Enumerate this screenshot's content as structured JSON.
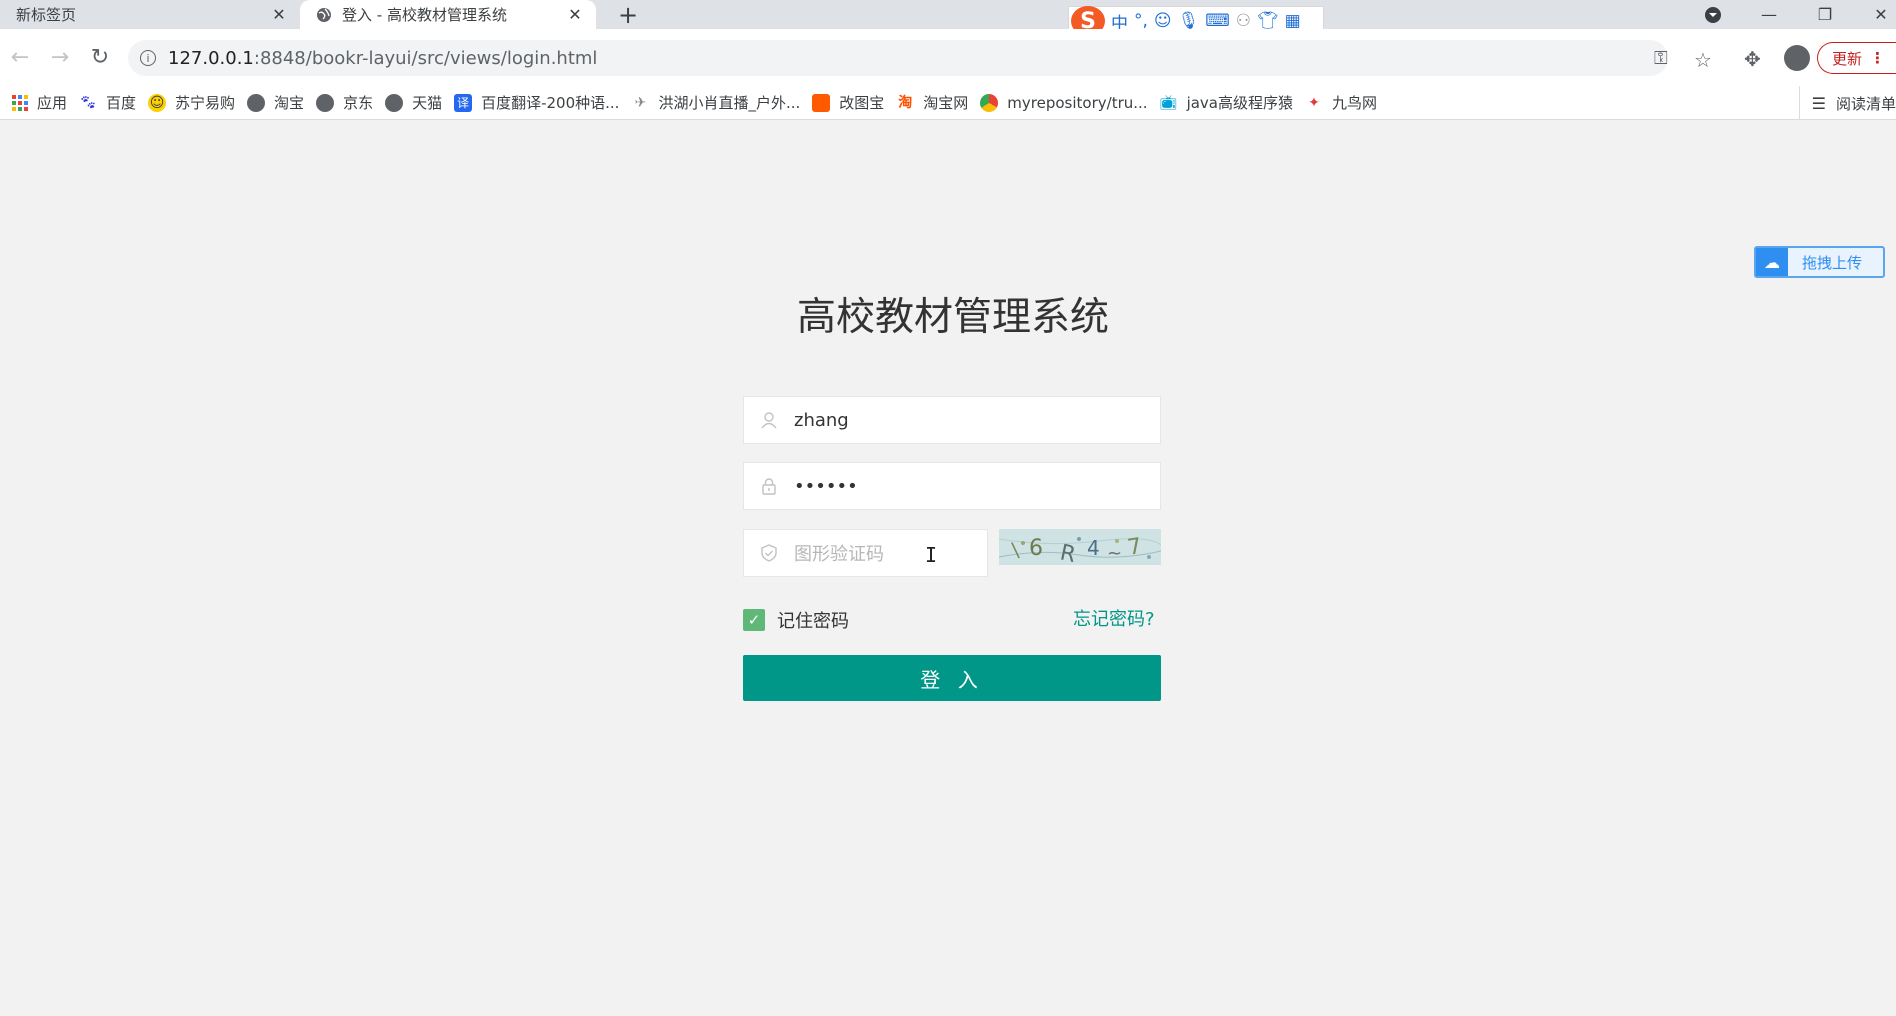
{
  "browser": {
    "tabs": [
      {
        "title": "新标签页",
        "close": "✕"
      },
      {
        "title": "登入 - 高校教材管理系统",
        "close": "✕"
      }
    ],
    "new_tab": "+",
    "url_host": "127.0.0.1",
    "url_rest": ":8848/bookr-layui/src/views/login.html",
    "update_label": "更新",
    "reading_list": "阅读清单",
    "ime": {
      "lang": "中",
      "punct": "°,"
    }
  },
  "bookmarks": [
    {
      "label": "应用"
    },
    {
      "label": "百度"
    },
    {
      "label": "苏宁易购"
    },
    {
      "label": "淘宝"
    },
    {
      "label": "京东"
    },
    {
      "label": "天猫"
    },
    {
      "label": "百度翻译-200种语..."
    },
    {
      "label": "洪湖小肖直播_户外..."
    },
    {
      "label": "改图宝"
    },
    {
      "label": "淘宝网"
    },
    {
      "label": "myrepository/tru..."
    },
    {
      "label": "java高级程序猿"
    },
    {
      "label": "九鸟网"
    }
  ],
  "float_widget": {
    "label": "拖拽上传"
  },
  "login": {
    "title": "高校教材管理系统",
    "username_value": "zhang",
    "password_value": "••••••",
    "captcha_placeholder": "图形验证码",
    "remember_label": "记住密码",
    "forgot_label": "忘记密码?",
    "submit_label": "登 入"
  },
  "colors": {
    "primary": "#009688",
    "checkbox": "#5fb878",
    "page_bg": "#f2f2f2"
  }
}
